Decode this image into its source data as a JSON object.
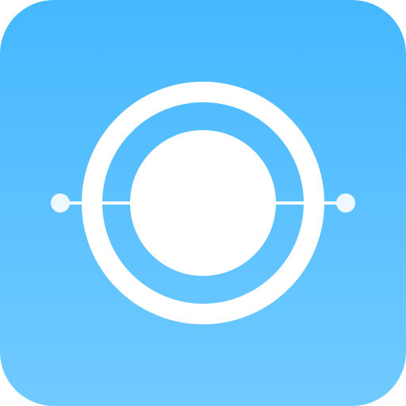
{
  "icon": {
    "name": "orbit-icon",
    "colors": {
      "gradient_top": "#45b8fe",
      "gradient_mid": "#5cc1ff",
      "gradient_bottom": "#70caff",
      "symbol": "#ffffff",
      "node": "#eef8ff"
    }
  }
}
